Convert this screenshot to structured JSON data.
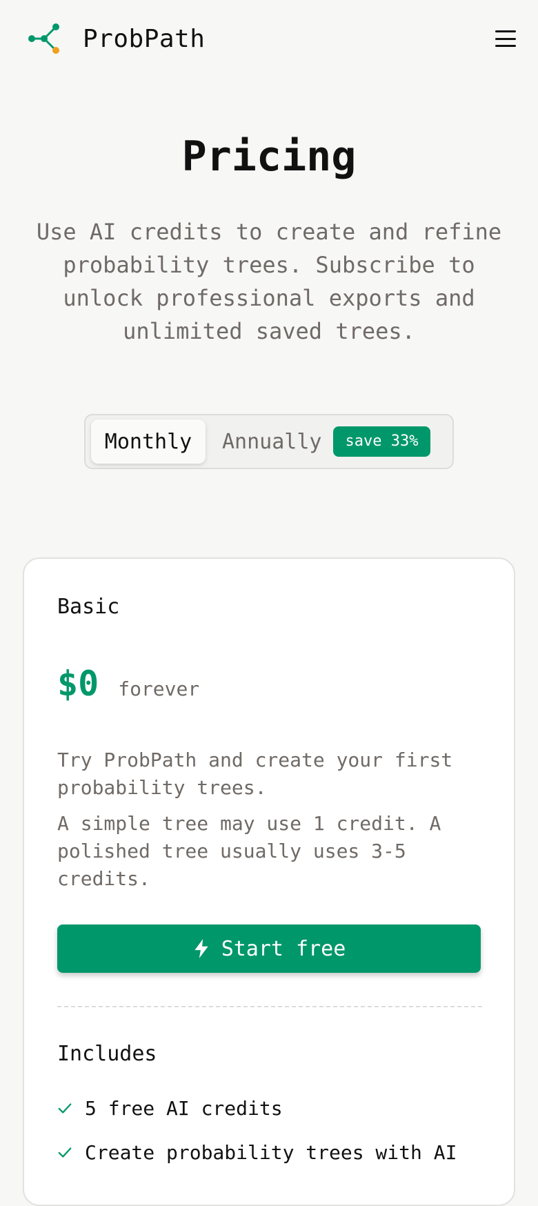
{
  "header": {
    "brand": "ProbPath",
    "logo_icon": "tree-nodes-icon",
    "menu_icon": "hamburger-menu-icon"
  },
  "hero": {
    "title": "Pricing",
    "subtitle": "Use AI credits to create and refine probability trees. Subscribe to unlock professional exports and unlimited saved trees."
  },
  "billing": {
    "monthly_label": "Monthly",
    "annual_label": "Annually",
    "save_badge": "save 33%",
    "selected": "Monthly"
  },
  "plan": {
    "name": "Basic",
    "price": "$0",
    "period": "forever",
    "description_1": "Try ProbPath and create your first probability trees.",
    "description_2": "A simple tree may use 1 credit. A polished tree usually uses 3-5 credits.",
    "cta_label": "Start free",
    "cta_icon": "lightning-icon",
    "includes_title": "Includes",
    "features": [
      "5 free AI credits",
      "Create probability trees with AI"
    ]
  },
  "colors": {
    "accent": "#00976a",
    "logo_orange": "#f0a020",
    "background": "#f7f7f6",
    "muted_text": "#6f6a66"
  }
}
